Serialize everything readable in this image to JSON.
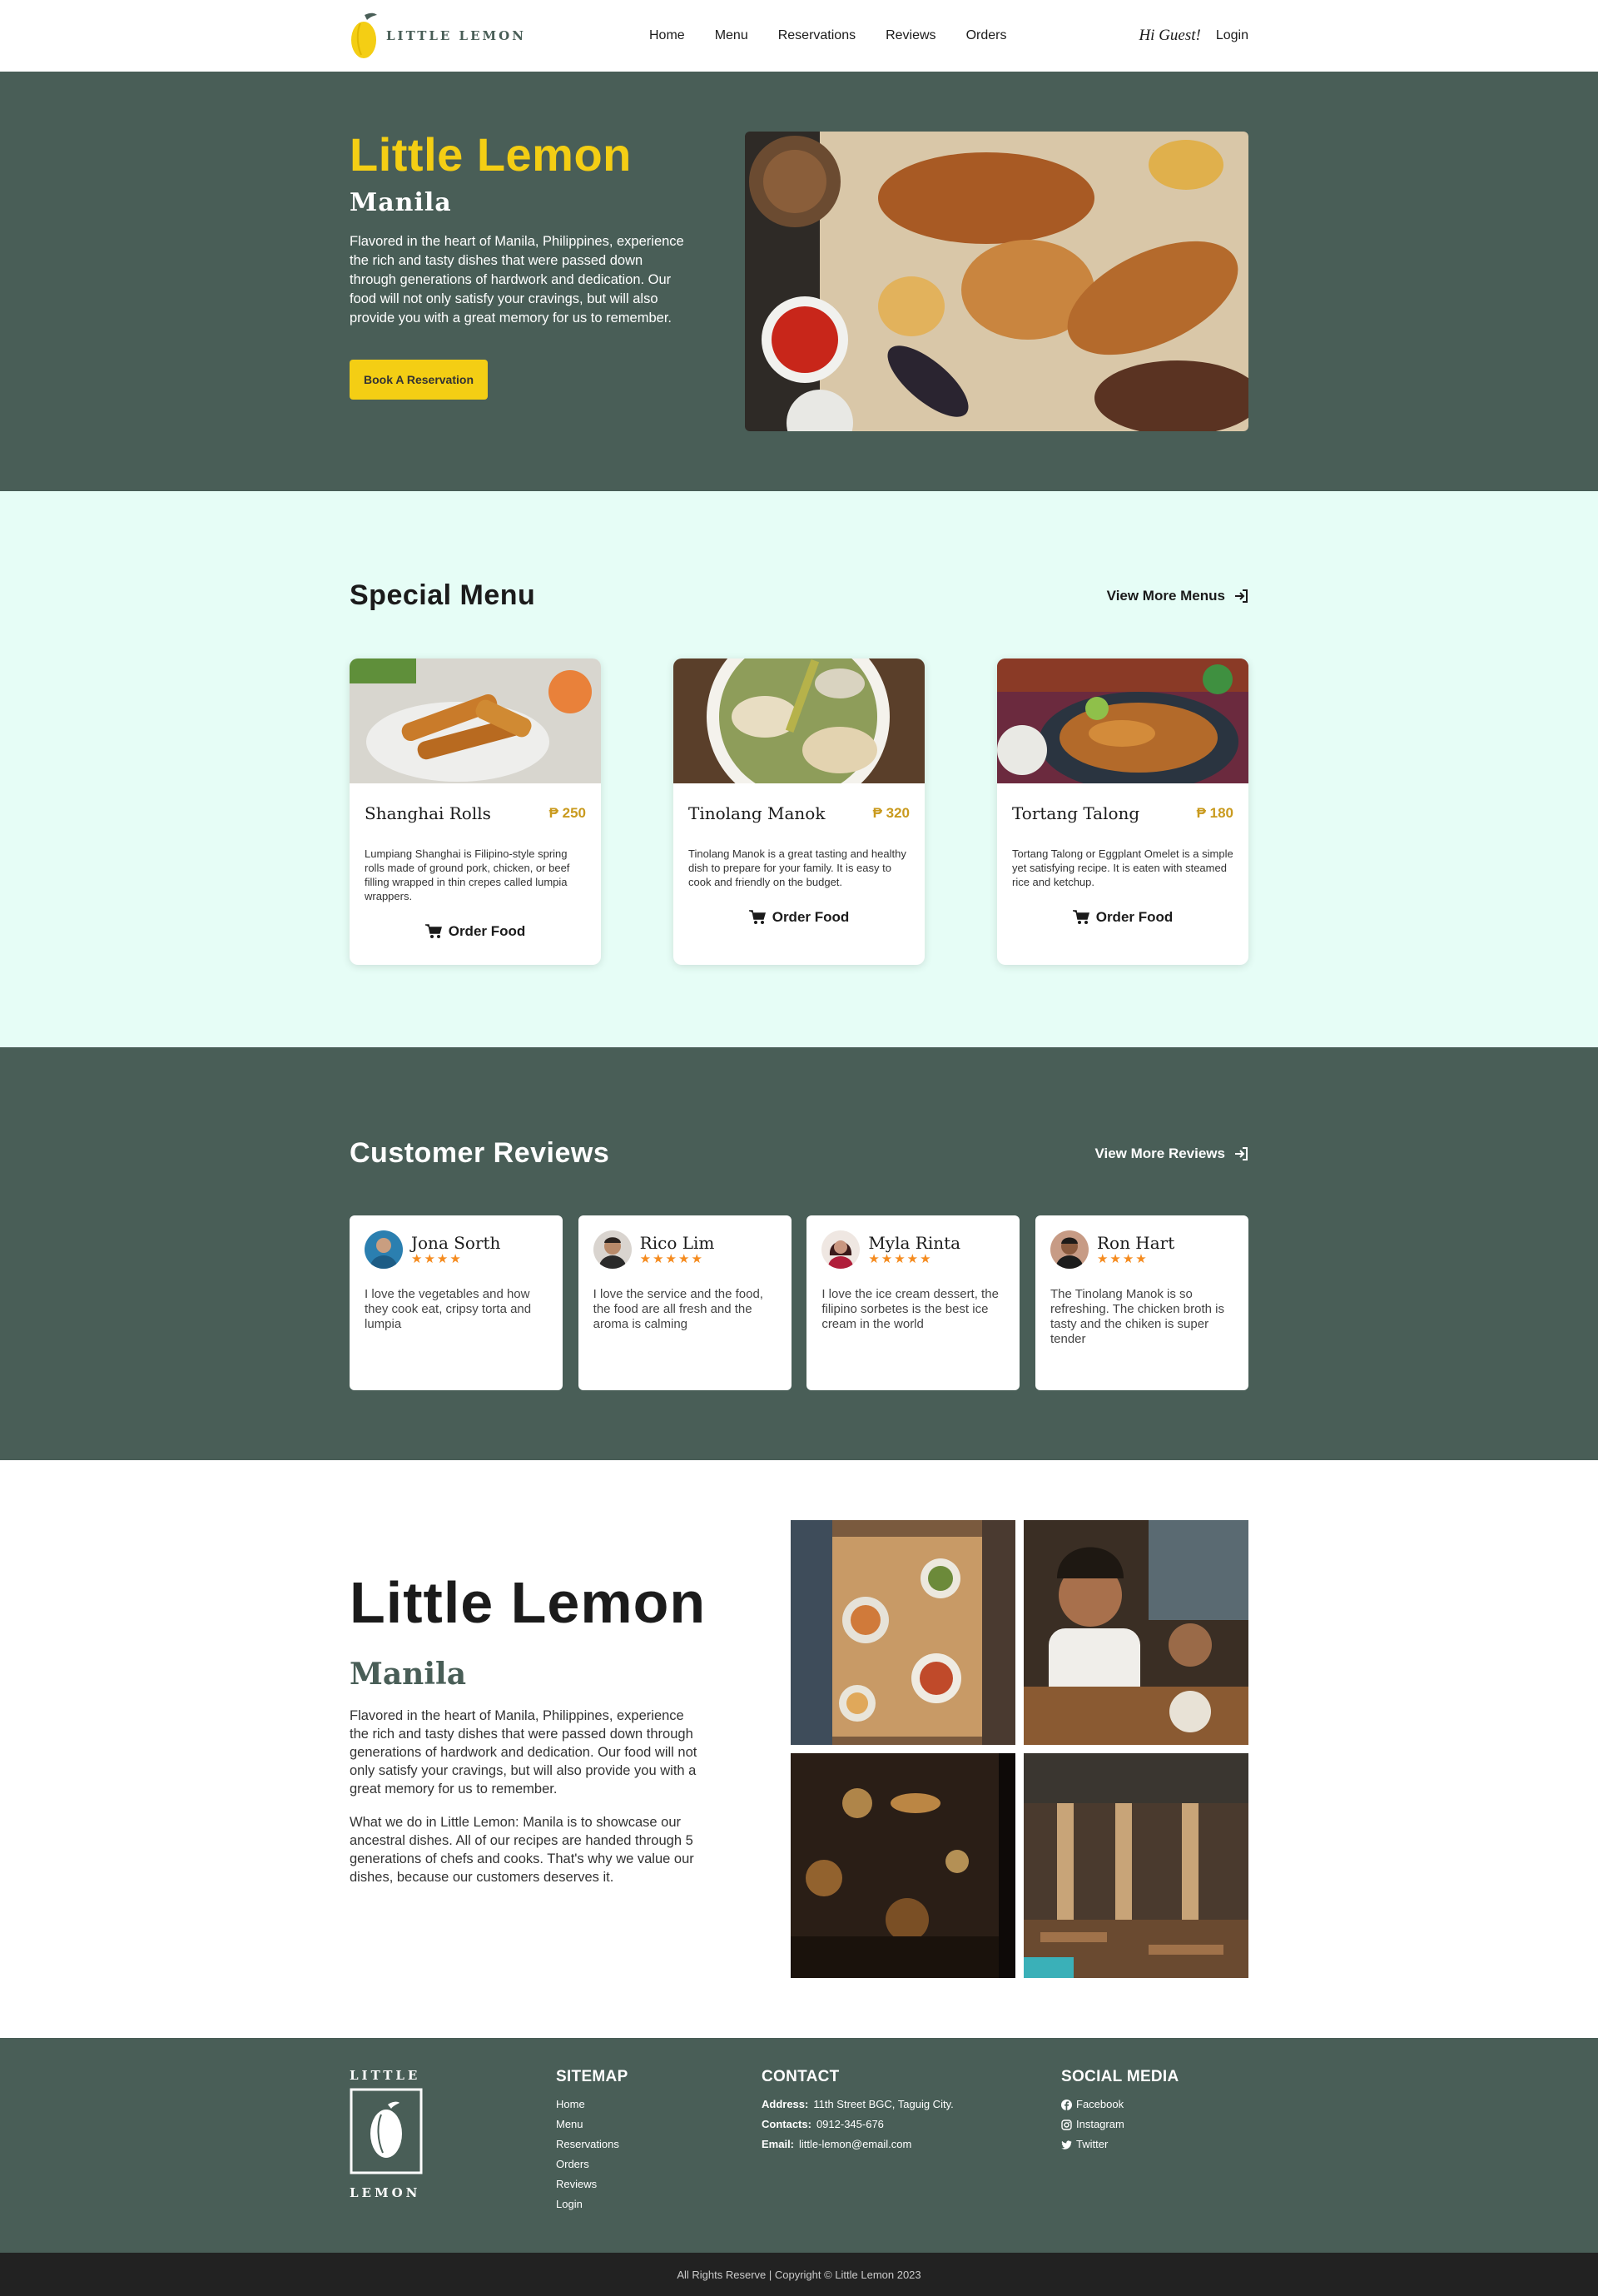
{
  "colors": {
    "brand_green": "#495e57",
    "brand_yellow": "#f4ce14",
    "mint": "#e6fdf6",
    "star": "#f58b1f"
  },
  "nav": {
    "logo_text": "LITTLE LEMON",
    "links": [
      "Home",
      "Menu",
      "Reservations",
      "Reviews",
      "Orders"
    ],
    "greeting": "Hi Guest!",
    "login": "Login"
  },
  "hero": {
    "title": "Little Lemon",
    "subtitle": "Manila",
    "text": "Flavored in the heart of Manila, Philippines, experience the rich and tasty dishes that were passed down through generations of hardwork and dedication. Our food will not only satisfy your cravings, but will also provide you with a great memory for us to remember.",
    "button": "Book A Reservation",
    "image": "grilled-meat-platter"
  },
  "specials": {
    "title": "Special Menu",
    "view_more": "View More Menus",
    "items": [
      {
        "name": "Shanghai Rolls",
        "price": "₱ 250",
        "desc": "Lumpiang Shanghai is Filipino-style spring rolls made of ground pork, chicken, or beef filling wrapped in thin crepes called lumpia wrappers.",
        "action": "Order Food",
        "image": "spring-rolls"
      },
      {
        "name": "Tinolang Manok",
        "price": "₱ 320",
        "desc": "Tinolang Manok is a great tasting and healthy dish to prepare for your family. It is easy to cook and friendly on the budget.",
        "action": "Order Food",
        "image": "chicken-soup"
      },
      {
        "name": "Tortang Talong",
        "price": "₱ 180",
        "desc": "Tortang Talong or Eggplant Omelet is a simple yet satisfying recipe. It is eaten with steamed rice and ketchup.",
        "action": "Order Food",
        "image": "eggplant-omelet"
      }
    ]
  },
  "reviews": {
    "title": "Customer Reviews",
    "view_more": "View More Reviews",
    "items": [
      {
        "name": "Jona Sorth",
        "stars": "★★★★",
        "rating": 4,
        "text": "I love the vegetables and how they cook eat, cripsy torta and lumpia"
      },
      {
        "name": "Rico Lim",
        "stars": "★★★★★",
        "rating": 5,
        "text": "I love the service and the food, the food are all fresh and the aroma is calming"
      },
      {
        "name": "Myla Rinta",
        "stars": "★★★★★",
        "rating": 5,
        "text": "I love the ice cream dessert, the filipino sorbetes is the best ice cream in the world"
      },
      {
        "name": "Ron Hart",
        "stars": "★★★★",
        "rating": 4,
        "text": "The Tinolang Manok is so refreshing. The chicken broth is tasty and the chiken is super tender"
      }
    ]
  },
  "about": {
    "title": "Little Lemon",
    "subtitle": "Manila",
    "text1": "Flavored in the heart of Manila, Philippines, experience the rich and tasty dishes that were passed down through generations of hardwork and dedication. Our food will not only satisfy your cravings, but will also provide you with a great memory for us to remember.",
    "text2": "What we do in Little Lemon: Manila is to showcase our ancestral dishes. All of our recipes are handed through 5 generations of chefs and cooks. That's why we value our dishes, because our customers deserves it.",
    "gallery": [
      "dining-table-overhead",
      "people-eating",
      "relax-sign-bar",
      "restaurant-interior"
    ]
  },
  "footer": {
    "logo_top": "LITTLE",
    "logo_bottom": "LEMON",
    "sitemap_title": "SITEMAP",
    "sitemap": [
      "Home",
      "Menu",
      "Reservations",
      "Orders",
      "Reviews",
      "Login"
    ],
    "contact_title": "CONTACT",
    "address_label": "Address:",
    "address": "11th Street BGC, Taguig City.",
    "contacts_label": "Contacts:",
    "contacts": "0912-345-676",
    "email_label": "Email:",
    "email": "little-lemon@email.com",
    "social_title": "SOCIAL MEDIA",
    "social": [
      "Facebook",
      "Instagram",
      "Twitter"
    ],
    "copyright": "All Rights Reserve | Copyright © Little Lemon 2023"
  }
}
